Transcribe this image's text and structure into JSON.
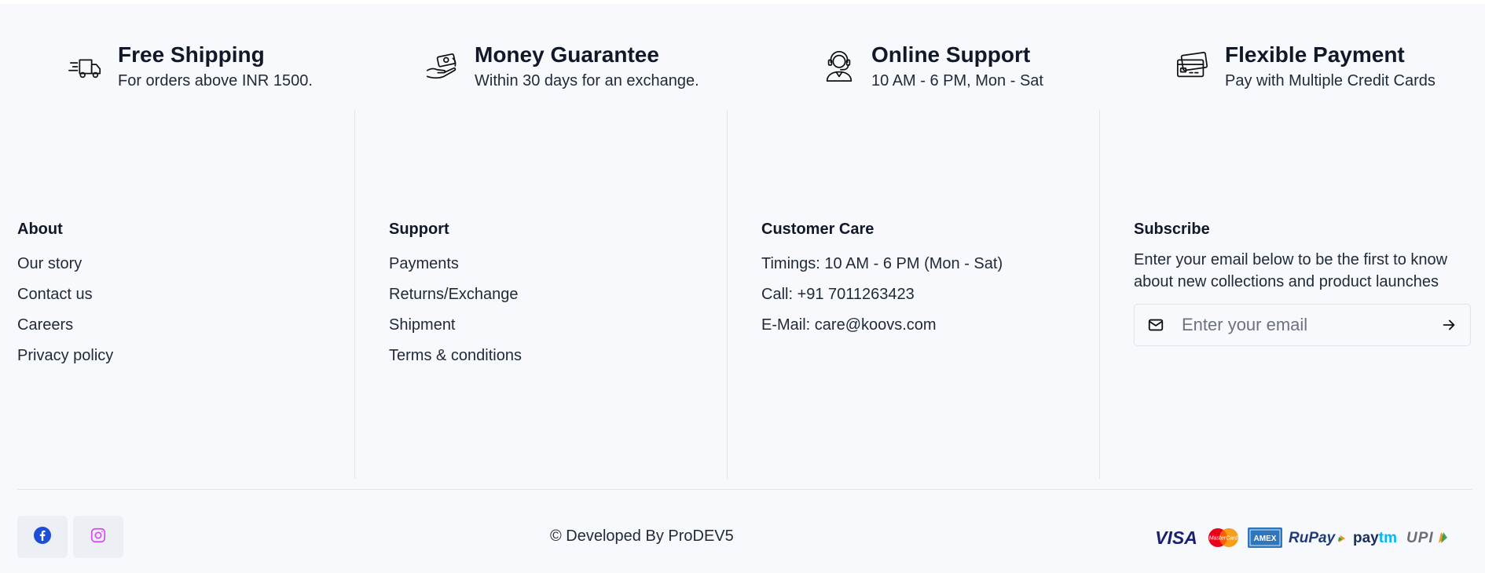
{
  "features": [
    {
      "icon": "truck-icon",
      "title": "Free Shipping",
      "subtitle": "For orders above INR 1500."
    },
    {
      "icon": "money-hand-icon",
      "title": "Money Guarantee",
      "subtitle": "Within 30 days for an exchange."
    },
    {
      "icon": "headset-support-icon",
      "title": "Online Support",
      "subtitle": "10 AM - 6 PM, Mon - Sat"
    },
    {
      "icon": "credit-cards-icon",
      "title": "Flexible Payment",
      "subtitle": "Pay with Multiple Credit Cards"
    }
  ],
  "about": {
    "heading": "About",
    "links": [
      "Our story",
      "Contact us",
      "Careers",
      "Privacy policy"
    ]
  },
  "support": {
    "heading": "Support",
    "links": [
      "Payments",
      "Returns/Exchange",
      "Shipment",
      "Terms & conditions"
    ]
  },
  "customer_care": {
    "heading": "Customer Care",
    "lines": [
      "Timings: 10 AM - 6 PM (Mon - Sat)",
      "Call: +91 7011263423",
      "E-Mail: care@koovs.com"
    ]
  },
  "subscribe": {
    "heading": "Subscribe",
    "description": "Enter your email below to be the first to know about new collections and product launches",
    "placeholder": "Enter your email"
  },
  "social": [
    {
      "icon": "facebook-icon",
      "color": "#1d4ed8"
    },
    {
      "icon": "instagram-icon",
      "color": "#d946ef"
    }
  ],
  "copyright": "© Developed By ProDEV5",
  "payment_methods": {
    "visa": "VISA",
    "mastercard": "MasterCard",
    "amex": "AMEX",
    "rupay": "RuPay",
    "paytm_pay": "pay",
    "paytm_tm": "tm",
    "upi": "UPI"
  },
  "colors": {
    "background": "#f7f9fc",
    "text": "#1f2937",
    "divider": "#e2e5ea"
  }
}
